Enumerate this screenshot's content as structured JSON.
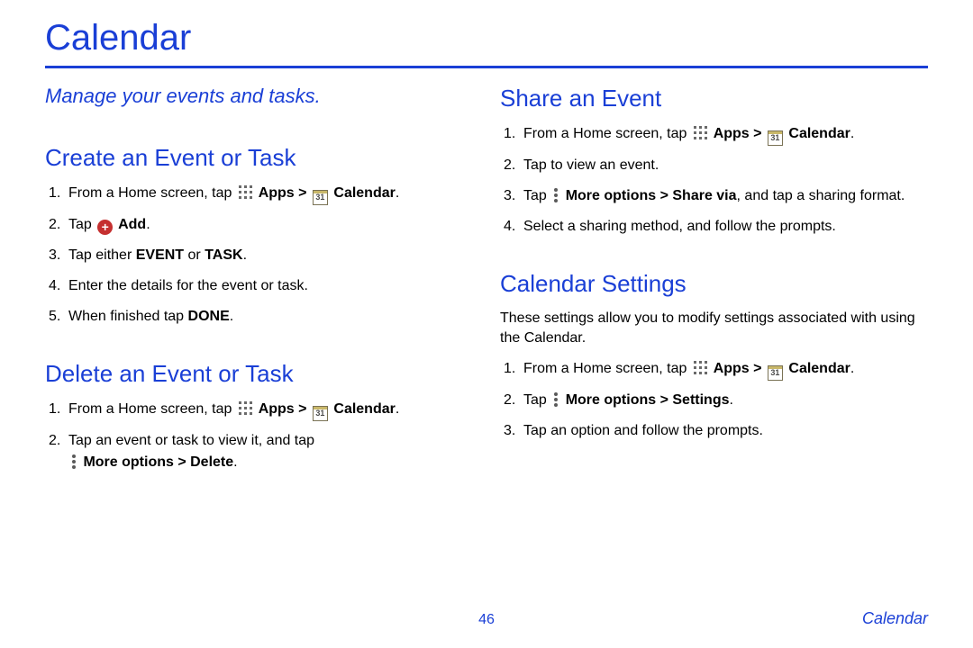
{
  "page": {
    "title": "Calendar",
    "subtitle": "Manage your events and tasks.",
    "number": "46",
    "footer_label": "Calendar"
  },
  "icons": {
    "calendar_day": "31",
    "add_symbol": "+"
  },
  "sections": {
    "create": {
      "heading": "Create an Event or Task",
      "steps": {
        "s1a": "From a Home screen, tap ",
        "s1_apps": " Apps > ",
        "s1_cal": " Calendar",
        "s1_end": ".",
        "s2a": "Tap ",
        "s2_add": " Add",
        "s2_end": ".",
        "s3a": "Tap either ",
        "s3_event": "EVENT",
        "s3_or": " or ",
        "s3_task": "TASK",
        "s3_end": ".",
        "s4": "Enter the details for the event or task.",
        "s5a": "When finished tap ",
        "s5_done": "DONE",
        "s5_end": "."
      }
    },
    "delete": {
      "heading": "Delete an Event or Task",
      "steps": {
        "s1a": "From a Home screen, tap ",
        "s1_apps": " Apps > ",
        "s1_cal": " Calendar",
        "s1_end": ".",
        "s2a": "Tap an event or task to view it, and tap ",
        "s2_more": " More options > Delete",
        "s2_end": "."
      }
    },
    "share": {
      "heading": "Share an Event",
      "steps": {
        "s1a": "From a Home screen, tap ",
        "s1_apps": " Apps > ",
        "s1_cal": " Calendar",
        "s1_end": ".",
        "s2": "Tap to view an event.",
        "s3a": "Tap ",
        "s3_more": " More options > Share via",
        "s3_mid": ", and tap a sharing format.",
        "s4": "Select a sharing method, and follow the prompts."
      }
    },
    "settings": {
      "heading": "Calendar Settings",
      "intro": "These settings allow you to modify settings associated with using the Calendar.",
      "steps": {
        "s1a": "From a Home screen, tap ",
        "s1_apps": " Apps > ",
        "s1_cal": " Calendar",
        "s1_end": ".",
        "s2a": "Tap ",
        "s2_more": " More options > Settings",
        "s2_end": ".",
        "s3": "Tap an option and follow the prompts."
      }
    }
  }
}
